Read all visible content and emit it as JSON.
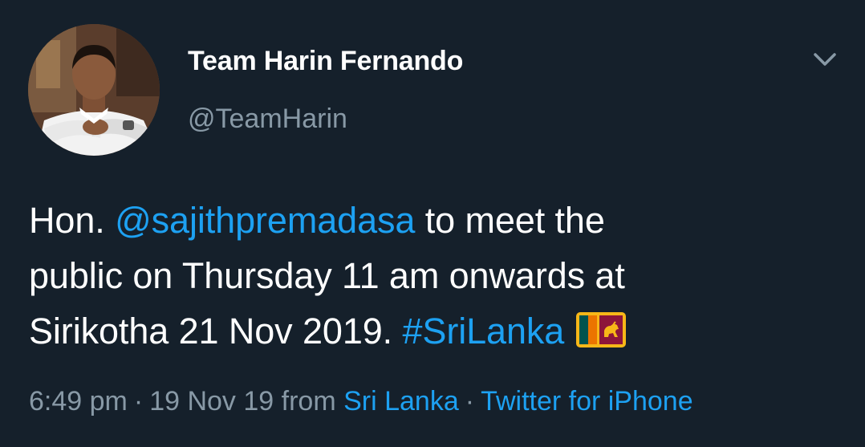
{
  "author": {
    "display_name": "Team Harin Fernando",
    "handle": "@TeamHarin",
    "avatar_icon": "profile-photo",
    "menu_icon": "chevron-down-icon"
  },
  "tweet": {
    "line1": {
      "prefix": "Hon. ",
      "mention": "@sajithpremadasa",
      "suffix": " to meet the"
    },
    "line2": "public on Thursday 11 am onwards at",
    "line3": {
      "text": "Sirikotha 21 Nov 2019. ",
      "hashtag": "#SriLanka",
      "emoji_icon": "sri-lanka-flag-icon"
    }
  },
  "meta": {
    "time": "6:49 pm",
    "separator": "·",
    "date": "19 Nov 19",
    "from_label": "from",
    "location": "Sri Lanka",
    "client": "Twitter for iPhone"
  },
  "colors": {
    "background": "#15202b",
    "text": "#ffffff",
    "muted": "#8899a6",
    "accent": "#1da1f2"
  }
}
